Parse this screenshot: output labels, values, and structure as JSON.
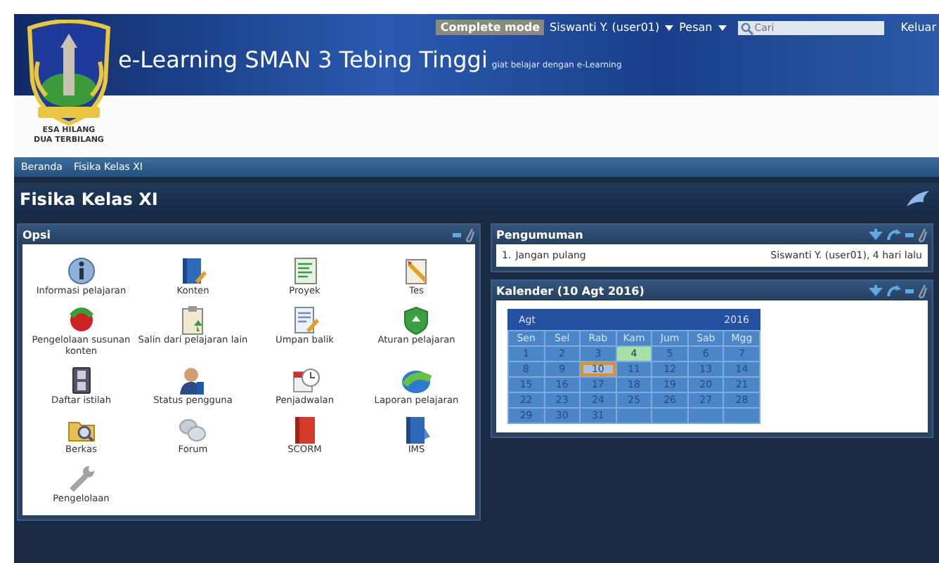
{
  "header": {
    "site_title": "e-Learning SMAN 3 Tebing Tinggi",
    "tagline": "giat belajar dengan e-Learning",
    "motto": "ESA HILANG\nDUA TERBILANG",
    "mode_badge": "Complete mode",
    "user_menu": "Siswanti Y. (user01)",
    "messages_menu": "Pesan",
    "search": {
      "placeholder": "Cari"
    },
    "logout": "Keluar"
  },
  "breadcrumb": [
    "Beranda",
    "Fisika Kelas XI"
  ],
  "page_title": "Fisika Kelas XI",
  "options_panel": {
    "title": "Opsi",
    "items": [
      {
        "label": "Informasi pelajaran"
      },
      {
        "label": "Konten"
      },
      {
        "label": "Proyek"
      },
      {
        "label": "Tes"
      },
      {
        "label": "Pengelolaan susunan konten"
      },
      {
        "label": "Salin dari pelajaran lain"
      },
      {
        "label": "Umpan balik"
      },
      {
        "label": "Aturan pelajaran"
      },
      {
        "label": "Daftar istilah"
      },
      {
        "label": "Status pengguna"
      },
      {
        "label": "Penjadwalan"
      },
      {
        "label": "Laporan pelajaran"
      },
      {
        "label": "Berkas"
      },
      {
        "label": "Forum"
      },
      {
        "label": "SCORM"
      },
      {
        "label": "IMS"
      },
      {
        "label": "Pengelolaan"
      }
    ]
  },
  "announcements_panel": {
    "title": "Pengumuman",
    "items": [
      {
        "number": "1.",
        "text": "Jangan pulang",
        "meta": "Siswanti Y. (user01), 4 hari lalu"
      }
    ]
  },
  "calendar_panel": {
    "title": "Kalender (10 Agt 2016)",
    "month": "Agt",
    "year": "2016",
    "weekdays": [
      "Sen",
      "Sel",
      "Rab",
      "Kam",
      "Jum",
      "Sab",
      "Mgg"
    ],
    "days": [
      {
        "label": "1",
        "event": false,
        "today": false
      },
      {
        "label": "2",
        "event": false,
        "today": false
      },
      {
        "label": "3",
        "event": false,
        "today": false
      },
      {
        "label": "4",
        "event": true,
        "today": false
      },
      {
        "label": "5",
        "event": false,
        "today": false
      },
      {
        "label": "6",
        "event": false,
        "today": false
      },
      {
        "label": "7",
        "event": false,
        "today": false
      },
      {
        "label": "8",
        "event": false,
        "today": false
      },
      {
        "label": "9",
        "event": false,
        "today": false
      },
      {
        "label": "10",
        "event": false,
        "today": true
      },
      {
        "label": "11",
        "event": false,
        "today": false
      },
      {
        "label": "12",
        "event": false,
        "today": false
      },
      {
        "label": "13",
        "event": false,
        "today": false
      },
      {
        "label": "14",
        "event": false,
        "today": false
      },
      {
        "label": "15",
        "event": false,
        "today": false
      },
      {
        "label": "16",
        "event": false,
        "today": false
      },
      {
        "label": "17",
        "event": false,
        "today": false
      },
      {
        "label": "18",
        "event": false,
        "today": false
      },
      {
        "label": "19",
        "event": false,
        "today": false
      },
      {
        "label": "20",
        "event": false,
        "today": false
      },
      {
        "label": "21",
        "event": false,
        "today": false
      },
      {
        "label": "22",
        "event": false,
        "today": false
      },
      {
        "label": "23",
        "event": false,
        "today": false
      },
      {
        "label": "24",
        "event": false,
        "today": false
      },
      {
        "label": "25",
        "event": false,
        "today": false
      },
      {
        "label": "26",
        "event": false,
        "today": false
      },
      {
        "label": "27",
        "event": false,
        "today": false
      },
      {
        "label": "28",
        "event": false,
        "today": false
      },
      {
        "label": "29",
        "event": false,
        "today": false
      },
      {
        "label": "30",
        "event": false,
        "today": false
      },
      {
        "label": "31",
        "event": false,
        "today": false
      }
    ]
  }
}
